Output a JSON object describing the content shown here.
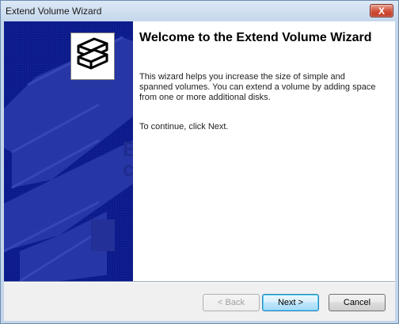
{
  "window": {
    "title": "Extend Volume Wizard",
    "close_glyph": "X"
  },
  "side_panel": {
    "background_color": "#0c1a8a",
    "icon": "stacked-disks-icon"
  },
  "content": {
    "heading": "Welcome to the Extend Volume Wizard",
    "description": "This wizard helps you increase the size of simple and spanned volumes. You can extend a volume  by adding space from one or more additional disks.",
    "instruction": "To continue, click Next."
  },
  "buttons": {
    "back_label": "< Back",
    "next_label": "Next >",
    "cancel_label": "Cancel"
  }
}
